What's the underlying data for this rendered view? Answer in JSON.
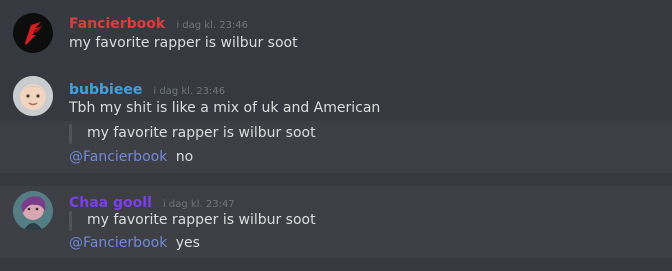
{
  "messages": [
    {
      "username": "Fancierbook",
      "timestamp": "i dag kl. 23:46",
      "text": "my favorite rapper is wilbur soot"
    },
    {
      "username": "bubbieee",
      "timestamp": "i dag kl. 23:46",
      "text": "Tbh my shit is like a mix of uk and American",
      "quote": "my favorite rapper is wilbur soot",
      "mention": "@Fancierbook",
      "reply": "no"
    },
    {
      "username": "Chaa gooll",
      "timestamp": "i dag kl. 23:47",
      "quote": "my favorite rapper is wilbur soot",
      "mention": "@Fancierbook",
      "reply": "yes"
    }
  ],
  "colors": {
    "background": "#36393f",
    "highlight": "#3d3f44",
    "fancierbook": "#e03b3b",
    "bubbieee": "#3fa1e0",
    "chaa": "#7a3ff0",
    "mention": "#7289da",
    "timestamp": "#72767d",
    "text": "#dcddde"
  }
}
